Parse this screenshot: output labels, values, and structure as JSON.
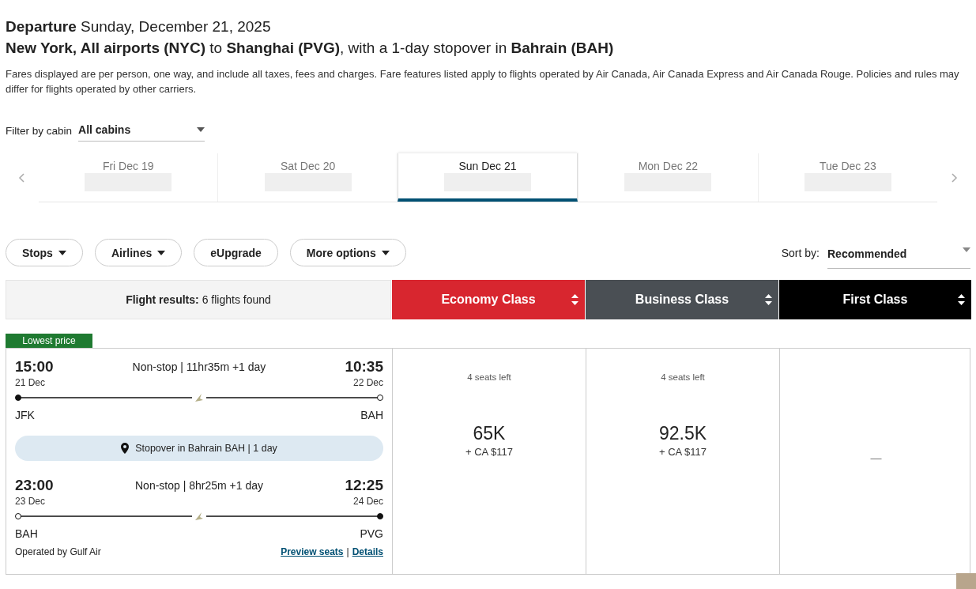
{
  "heading": {
    "departure": "**Departure** Sunday, December 21, 2025",
    "route": "**New York, All airports (NYC)** to **Shanghai (PVG)**, with a 1-day stopover in **Bahrain (BAH)**"
  },
  "disclaimer": "Fares displayed are per person, one way, and include all taxes, fees and charges. Fare features listed apply to flights operated by Air Canada, Air Canada Express and Air Canada Rouge. Policies and rules may differ for flights operated by other carriers.",
  "cabin_filter": {
    "label": "Filter by cabin",
    "value": "All cabins"
  },
  "date_tabs": [
    {
      "label": "Fri Dec 19",
      "selected": false
    },
    {
      "label": "Sat Dec 20",
      "selected": false
    },
    {
      "label": "Sun Dec 21",
      "selected": true
    },
    {
      "label": "Mon Dec 22",
      "selected": false
    },
    {
      "label": "Tue Dec 23",
      "selected": false
    }
  ],
  "filters": [
    {
      "label": "Stops",
      "dropdown": true
    },
    {
      "label": "Airlines",
      "dropdown": true
    },
    {
      "label": "eUpgrade",
      "dropdown": false
    },
    {
      "label": "More options",
      "dropdown": true
    }
  ],
  "sort": {
    "label": "Sort by:",
    "value": "Recommended"
  },
  "results": {
    "label": "Flight results:",
    "count": "6 flights found"
  },
  "cabins": [
    {
      "label": "Economy Class",
      "color": "#d8262f"
    },
    {
      "label": "Business Class",
      "color": "#4a4f54"
    },
    {
      "label": "First Class",
      "color": "#000000"
    }
  ],
  "flight": {
    "badge": "Lowest price",
    "segments": [
      {
        "depart_time": "15:00",
        "depart_date": "21 Dec",
        "origin": "JFK",
        "duration": "Non-stop | 11hr35m +1 day",
        "arrive_time": "10:35",
        "arrive_date": "22 Dec",
        "destination": "BAH"
      },
      {
        "depart_time": "23:00",
        "depart_date": "23 Dec",
        "origin": "BAH",
        "duration": "Non-stop | 8hr25m +1 day",
        "arrive_time": "12:25",
        "arrive_date": "24 Dec",
        "destination": "PVG"
      }
    ],
    "stopover": "Stopover in Bahrain BAH | 1 day",
    "operator": "Operated by Gulf Air",
    "links": [
      "Preview seats",
      "Details"
    ],
    "link_separator": "|",
    "fares": [
      {
        "kind": "price",
        "seats": "4 seats left",
        "points": "65K",
        "cash": "+ CA $117"
      },
      {
        "kind": "price",
        "seats": "4 seats left",
        "points": "92.5K",
        "cash": "+ CA $117"
      },
      {
        "kind": "unavailable",
        "text": "—"
      }
    ]
  }
}
